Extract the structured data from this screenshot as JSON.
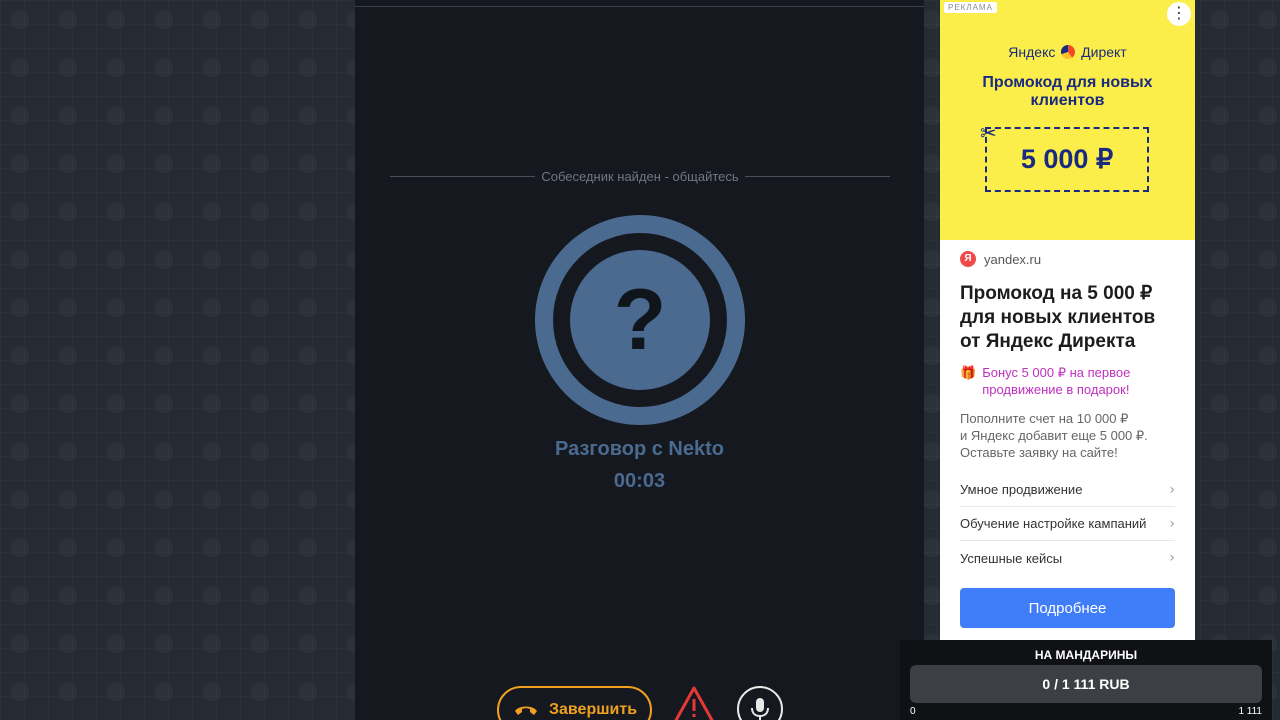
{
  "chat": {
    "status_text": "Собеседник найден - общайтесь",
    "avatar_symbol": "?",
    "call_title": "Разговор с Nekto",
    "call_timer": "00:03",
    "end_button_label": "Завершить",
    "icons": {
      "end": "phone-hangup-icon",
      "report": "warning-icon",
      "mic": "microphone-icon"
    },
    "colors": {
      "accent_blue": "#4a6a8f",
      "end_orange": "#f0a020",
      "report_red": "#e53935"
    }
  },
  "ad": {
    "label": "РЕКЛАМА",
    "menu_symbol": "⋮",
    "brand_left": "Яндекс",
    "brand_right": "Директ",
    "headline": "Промокод для новых клиентов",
    "scissors_symbol": "✂",
    "promo_amount": "5 000 ₽",
    "site_letter": "Я",
    "site": "yandex.ru",
    "title": "Промокод на 5 000 ₽ для новых клиентов от Яндекс Директа",
    "bonus_icon": "gift-icon",
    "bonus_symbol": "🎁",
    "bonus_text": "Бонус 5 000 ₽ на первое продвижение в подарок!",
    "description": "Пополните счет на 10 000 ₽\nи Яндекс добавит еще 5 000 ₽.\nОставьте заявку на сайте!",
    "links": [
      "Умное продвижение",
      "Обучение настройке кампаний",
      "Успешные кейсы"
    ],
    "chevron_symbol": "›",
    "cta": "Подробнее",
    "colors": {
      "banner_yellow": "#fbee4b",
      "brand_navy": "#1a2a80",
      "bonus_purple": "#c030c0",
      "cta_blue": "#3f7ef8"
    }
  },
  "donation": {
    "title": "НА МАНДАРИНЫ",
    "amount": "0 / 1 111 RUB",
    "progress_fraction": 0,
    "min_label": "0",
    "max_label": "1 111"
  }
}
